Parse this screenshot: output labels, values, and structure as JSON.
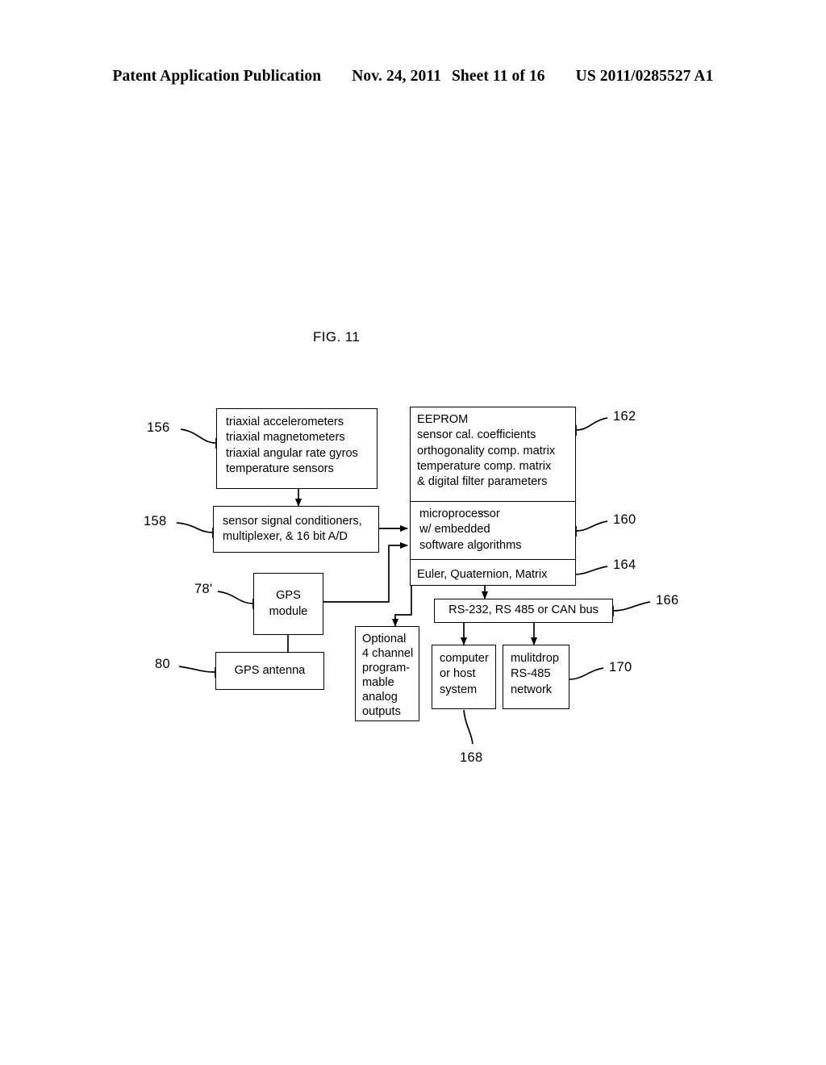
{
  "header": {
    "publication": "Patent Application Publication",
    "date": "Nov. 24, 2011",
    "sheet": "Sheet 11 of 16",
    "patent_number": "US 2011/0285527 A1"
  },
  "figure": {
    "title": "FIG. 11"
  },
  "blocks": {
    "sensors": {
      "lines": [
        "triaxial accelerometers",
        "triaxial magnetometers",
        "triaxial angular rate gyros",
        "temperature sensors"
      ]
    },
    "conditioners": {
      "lines": [
        "sensor signal conditioners,",
        "multiplexer, & 16 bit A/D"
      ]
    },
    "eeprom": {
      "lines": [
        "EEPROM",
        "sensor cal. coefficients",
        "orthogonality comp. matrix",
        "temperature comp. matrix",
        "& digital filter parameters"
      ]
    },
    "microprocessor": {
      "lines": [
        "microprocessor",
        "w/  embedded",
        "software algorithms"
      ]
    },
    "euler": {
      "lines": [
        "Euler, Quaternion, Matrix"
      ]
    },
    "gps_module": {
      "lines": [
        "GPS",
        "module"
      ]
    },
    "gps_antenna": {
      "lines": [
        "GPS antenna"
      ]
    },
    "analog_outputs": {
      "lines": [
        "Optional",
        "4 channel",
        "program-",
        "mable",
        "analog",
        "outputs"
      ]
    },
    "bus": {
      "lines": [
        "RS-232, RS 485 or CAN bus"
      ]
    },
    "host": {
      "lines": [
        "computer",
        "or host",
        "system"
      ]
    },
    "network": {
      "lines": [
        "mulitdrop",
        "RS-485",
        "network"
      ]
    }
  },
  "reference_numerals": {
    "sensors": "156",
    "conditioners": "158",
    "gps_module": "78'",
    "gps_antenna": "80",
    "eeprom": "162",
    "microprocessor": "160",
    "euler": "164",
    "bus": "166",
    "host": "168",
    "network": "170"
  },
  "colors": {
    "ink": "#000000",
    "paper": "#ffffff"
  }
}
